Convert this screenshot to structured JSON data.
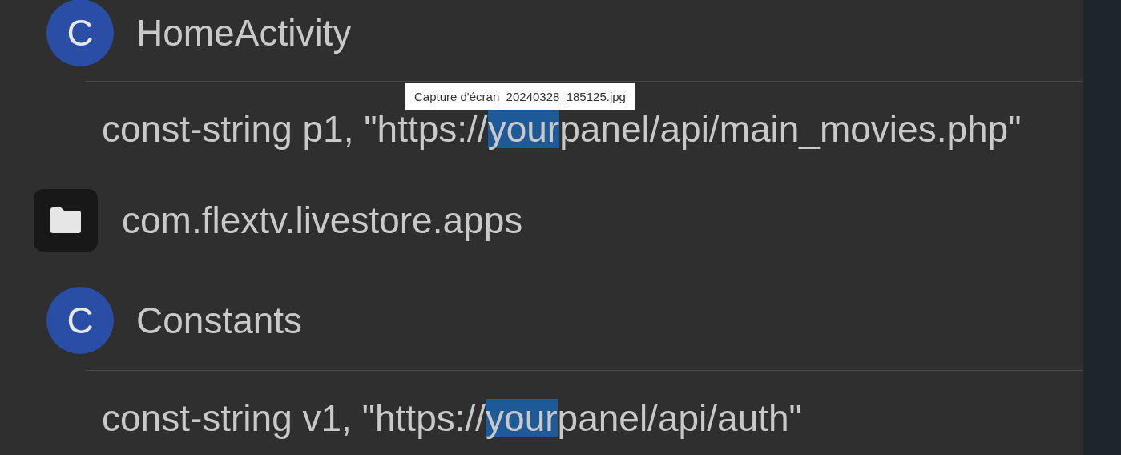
{
  "results": [
    {
      "kind": "class",
      "icon_letter": "C",
      "name": "HomeActivity",
      "matches": [
        {
          "before": "const-string p1, \"https://",
          "highlight": "your",
          "after": "panel/api/main_movies.php\"",
          "selected": true
        }
      ]
    },
    {
      "kind": "package",
      "name": "com.flextv.livestore.apps"
    },
    {
      "kind": "class",
      "icon_letter": "C",
      "name": "Constants",
      "matches": [
        {
          "before": "const-string v1, \"https://",
          "highlight": "your",
          "after": "panel/api/auth\"",
          "selected": true
        }
      ]
    }
  ],
  "tooltip": {
    "text": "Capture d'écran_20240328_185125.jpg"
  }
}
